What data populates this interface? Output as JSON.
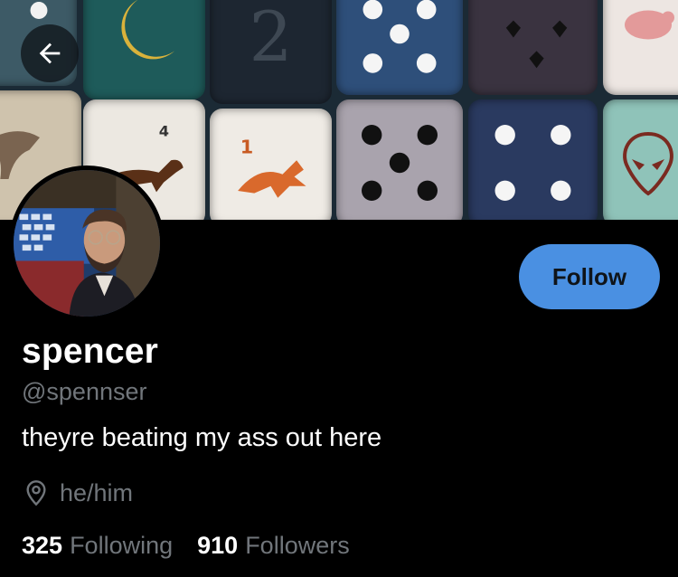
{
  "colors": {
    "background": "#000000",
    "accent": "#4a90e2",
    "secondary_text": "#71767b",
    "primary_text": "#ffffff"
  },
  "header": {
    "back_icon": "arrow-left-icon"
  },
  "profile": {
    "display_name": "spencer",
    "handle": "@spennser",
    "bio": "theyre beating my ass out here",
    "location_icon": "location-pin-icon",
    "pronouns": "he/him",
    "follow_label": "Follow"
  },
  "stats": {
    "following_count": "325",
    "following_label": "Following",
    "followers_count": "910",
    "followers_label": "Followers"
  }
}
